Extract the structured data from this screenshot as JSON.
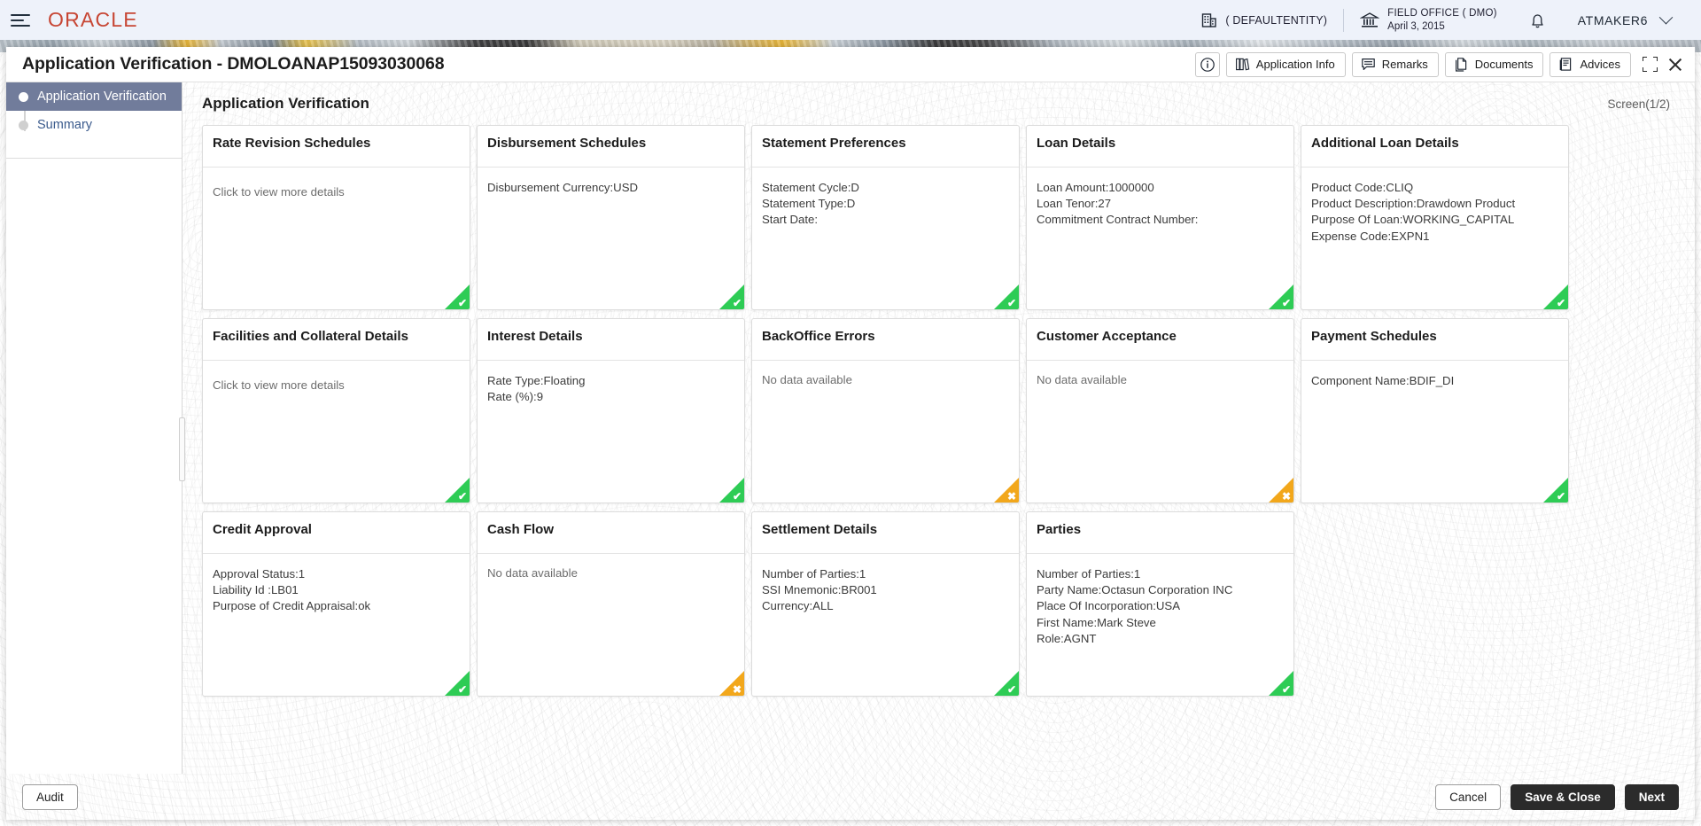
{
  "topbar": {
    "menu_icon": "hamburger-icon",
    "brand": "ORACLE",
    "entity": "( DEFAULTENTITY)",
    "entity_icon": "building-icon",
    "branch": "FIELD OFFICE ( DMO)",
    "branch_date": "April 3, 2015",
    "branch_icon": "bank-icon",
    "notification_icon": "bell-icon",
    "user": "ATMAKER6",
    "user_chevron_icon": "chevron-down-icon"
  },
  "modal": {
    "title": "Application Verification - DMOLOANAP15093030068",
    "info_icon": "info-icon",
    "actions": [
      {
        "label": "Application Info",
        "icon": "library-icon"
      },
      {
        "label": "Remarks",
        "icon": "comment-icon"
      },
      {
        "label": "Documents",
        "icon": "document-icon"
      },
      {
        "label": "Advices",
        "icon": "advice-icon"
      }
    ],
    "minimize_icon": "collapse-icon",
    "close_icon": "close-icon"
  },
  "sidebar": {
    "items": [
      {
        "label": "Application Verification",
        "active": true
      },
      {
        "label": "Summary",
        "active": false
      }
    ]
  },
  "content": {
    "title": "Application Verification",
    "screen_count": "Screen(1/2)",
    "cards": [
      {
        "title": "Rate Revision Schedules",
        "placeholder": "Click to view more details",
        "lines": [],
        "status": "ok"
      },
      {
        "title": "Disbursement Schedules",
        "placeholder": "",
        "lines": [
          "Disbursement Currency:USD"
        ],
        "status": "ok"
      },
      {
        "title": "Statement Preferences",
        "placeholder": "",
        "lines": [
          "Statement Cycle:D",
          "Statement Type:D",
          "Start Date:"
        ],
        "status": "ok"
      },
      {
        "title": "Loan Details",
        "placeholder": "",
        "lines": [
          "Loan Amount:1000000",
          "Loan Tenor:27",
          "Commitment Contract Number:"
        ],
        "status": "ok"
      },
      {
        "title": "Additional Loan Details",
        "placeholder": "",
        "lines": [
          "Product Code:CLIQ",
          "Product Description:Drawdown Product",
          "Purpose Of Loan:WORKING_CAPITAL",
          "Expense Code:EXPN1"
        ],
        "status": "ok"
      },
      {
        "title": "Facilities and Collateral Details",
        "placeholder": "Click to view more details",
        "lines": [],
        "status": "ok"
      },
      {
        "title": "Interest Details",
        "placeholder": "",
        "lines": [
          "Rate Type:Floating",
          "Rate (%):9"
        ],
        "status": "ok"
      },
      {
        "title": "BackOffice Errors",
        "placeholder": "",
        "lines": [
          "No data available"
        ],
        "status": "warn"
      },
      {
        "title": "Customer Acceptance",
        "placeholder": "",
        "lines": [
          "No data available"
        ],
        "status": "warn"
      },
      {
        "title": "Payment Schedules",
        "placeholder": "",
        "lines": [
          "Component Name:BDIF_DI"
        ],
        "status": "ok"
      },
      {
        "title": "Credit Approval",
        "placeholder": "",
        "lines": [
          "Approval Status:1",
          "Liability Id :LB01",
          "Purpose of Credit Appraisal:ok"
        ],
        "status": "ok"
      },
      {
        "title": "Cash Flow",
        "placeholder": "",
        "lines": [
          "No data available"
        ],
        "status": "warn"
      },
      {
        "title": "Settlement Details",
        "placeholder": "",
        "lines": [
          "Number of Parties:1",
          "SSI Mnemonic:BR001",
          "Currency:ALL"
        ],
        "status": "ok"
      },
      {
        "title": "Parties",
        "placeholder": "",
        "lines": [
          "Number of Parties:1",
          "Party Name:Octasun Corporation INC",
          "Place Of Incorporation:USA",
          "First Name:Mark Steve",
          "Role:AGNT"
        ],
        "status": "ok"
      }
    ]
  },
  "footer": {
    "audit_label": "Audit",
    "cancel_label": "Cancel",
    "save_close_label": "Save & Close",
    "next_label": "Next"
  },
  "colors": {
    "brand": "#C74634",
    "status_ok": "#2ecc55",
    "status_warn": "#f2a71b",
    "active_step": "#717c9b",
    "dark_button": "#2b2b2b"
  },
  "status_marks": {
    "ok": "✔",
    "warn": "✖"
  }
}
